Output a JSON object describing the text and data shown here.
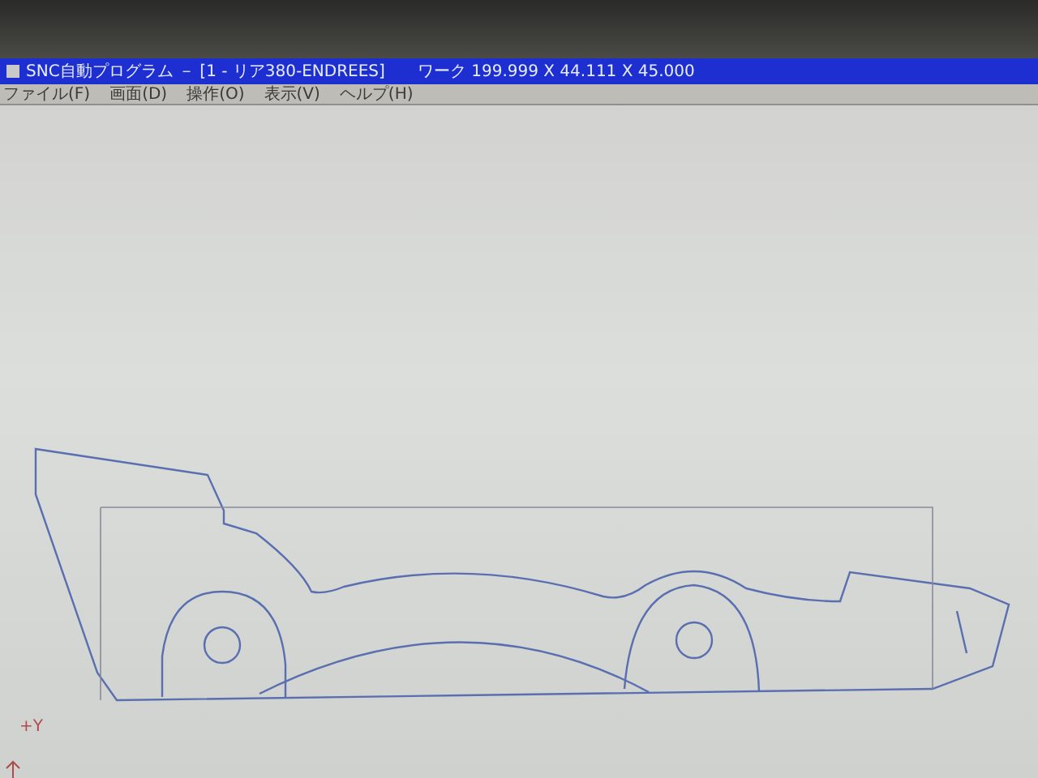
{
  "window": {
    "title": "SNC自動プログラム － [1 - リア380-ENDREES]",
    "work_size": "ワーク  199.999 X 44.111 X 45.000"
  },
  "menu": [
    "ファイル(F)",
    "画面(D)",
    "操作(O)",
    "表示(V)",
    "ヘルプ(H)"
  ],
  "canvas": {
    "axis_label": "+Y"
  }
}
